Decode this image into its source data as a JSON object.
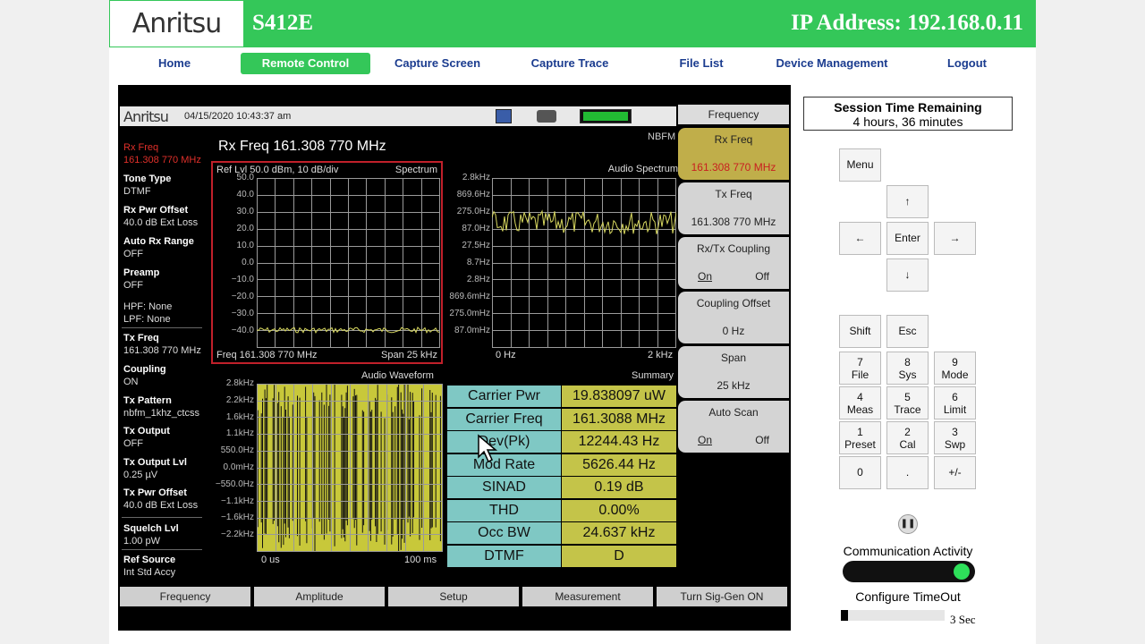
{
  "header": {
    "logo": "Anritsu",
    "model": "S412E",
    "ip_label": "IP Address: 192.168.0.11"
  },
  "nav": [
    "Home",
    "Remote Control",
    "Capture Screen",
    "Capture Trace",
    "File List",
    "Device Management",
    "Logout"
  ],
  "screen": {
    "logo": "Anritsu",
    "datetime": "04/15/2020 10:43:37 am",
    "mode": "NBFM",
    "main_title": "Rx Freq 161.308 770 MHz",
    "left_params": [
      {
        "label": "Rx Freq",
        "value": "161.308 770 MHz"
      },
      {
        "label": "Tone Type",
        "value": "DTMF"
      },
      {
        "label": "Rx Pwr Offset",
        "value": "40.0 dB Ext Loss"
      },
      {
        "label": "Auto Rx Range",
        "value": "OFF"
      },
      {
        "label": "Preamp",
        "value": "OFF"
      },
      {
        "label": "HPF: None",
        "value": "LPF: None"
      },
      {
        "label": "Tx Freq",
        "value": "161.308 770 MHz"
      },
      {
        "label": "Coupling",
        "value": "ON"
      },
      {
        "label": "Tx Pattern",
        "value": "nbfm_1khz_ctcss"
      },
      {
        "label": "Tx Output",
        "value": "OFF"
      },
      {
        "label": "Tx Output Lvl",
        "value": "0.25 µV"
      },
      {
        "label": "Tx Pwr Offset",
        "value": "40.0 dB Ext Loss"
      },
      {
        "label": "Squelch Lvl",
        "value": "1.00 pW"
      },
      {
        "label": "Ref Source",
        "value": "Int Std Accy"
      }
    ],
    "spectrum": {
      "header_left": "Ref Lvl 50.0 dBm,  10 dB/div",
      "header_right": "Spectrum",
      "y_ticks": [
        "50.0",
        "40.0",
        "30.0",
        "20.0",
        "10.0",
        "0.0",
        "−10.0",
        "−20.0",
        "−30.0",
        "−40.0"
      ],
      "footer_left": "Freq 161.308 770 MHz",
      "footer_right": "Span 25 kHz"
    },
    "audio_spectrum": {
      "title": "Audio Spectrum",
      "y_ticks": [
        "2.8kHz",
        "869.6Hz",
        "275.0Hz",
        "87.0Hz",
        "27.5Hz",
        "8.7Hz",
        "2.8Hz",
        "869.6mHz",
        "275.0mHz",
        "87.0mHz"
      ],
      "x_left": "0 Hz",
      "x_right": "2 kHz"
    },
    "audio_waveform": {
      "title": "Audio Waveform",
      "y_ticks": [
        "2.8kHz",
        "2.2kHz",
        "1.6kHz",
        "1.1kHz",
        "550.0Hz",
        "0.0mHz",
        "−550.0Hz",
        "−1.1kHz",
        "−1.6kHz",
        "−2.2kHz"
      ],
      "x_left": "0 us",
      "x_right": "100 ms"
    },
    "summary": {
      "title": "Summary",
      "rows": [
        {
          "label": "Carrier Pwr",
          "value": "19.838097 uW"
        },
        {
          "label": "Carrier Freq",
          "value": "161.3088 MHz"
        },
        {
          "label": "Dev(Pk)",
          "value": "12244.43 Hz"
        },
        {
          "label": "Mod Rate",
          "value": "5626.44 Hz"
        },
        {
          "label": "SINAD",
          "value": "0.19 dB"
        },
        {
          "label": "THD",
          "value": "0.00%"
        },
        {
          "label": "Occ BW",
          "value": "24.637 kHz"
        },
        {
          "label": "DTMF",
          "value": "D"
        }
      ]
    },
    "softkey_header": "Frequency",
    "softkeys": [
      {
        "title": "Rx Freq",
        "value": "161.308 770 MHz"
      },
      {
        "title": "Tx Freq",
        "value": "161.308 770 MHz"
      },
      {
        "title": "Rx/Tx Coupling",
        "on": "On",
        "off": "Off"
      },
      {
        "title": "Coupling Offset",
        "value": "0 Hz"
      },
      {
        "title": "Span",
        "value": "25 kHz"
      },
      {
        "title": "Auto Scan",
        "on": "On",
        "off": "Off"
      }
    ],
    "bottom_keys": [
      "Frequency",
      "Amplitude",
      "Setup",
      "Measurement",
      "Turn Sig-Gen ON"
    ]
  },
  "side": {
    "session_title": "Session Time Remaining",
    "session_value": "4 hours, 36 minutes",
    "keys": {
      "menu": "Menu",
      "up": "↑",
      "left": "←",
      "enter": "Enter",
      "right": "→",
      "down": "↓",
      "shift": "Shift",
      "esc": "Esc",
      "k7": "7",
      "k7s": "File",
      "k8": "8",
      "k8s": "Sys",
      "k9": "9",
      "k9s": "Mode",
      "k4": "4",
      "k4s": "Meas",
      "k5": "5",
      "k5s": "Trace",
      "k6": "6",
      "k6s": "Limit",
      "k1": "1",
      "k1s": "Preset",
      "k2": "2",
      "k2s": "Cal",
      "k3": "3",
      "k3s": "Swp",
      "k0": "0",
      "dot": ".",
      "pm": "+/-"
    },
    "comm_label": "Communication Activity",
    "configure_label": "Configure TimeOut",
    "timeout_value": "3 Sec",
    "timeout_fraction": 0.0
  }
}
